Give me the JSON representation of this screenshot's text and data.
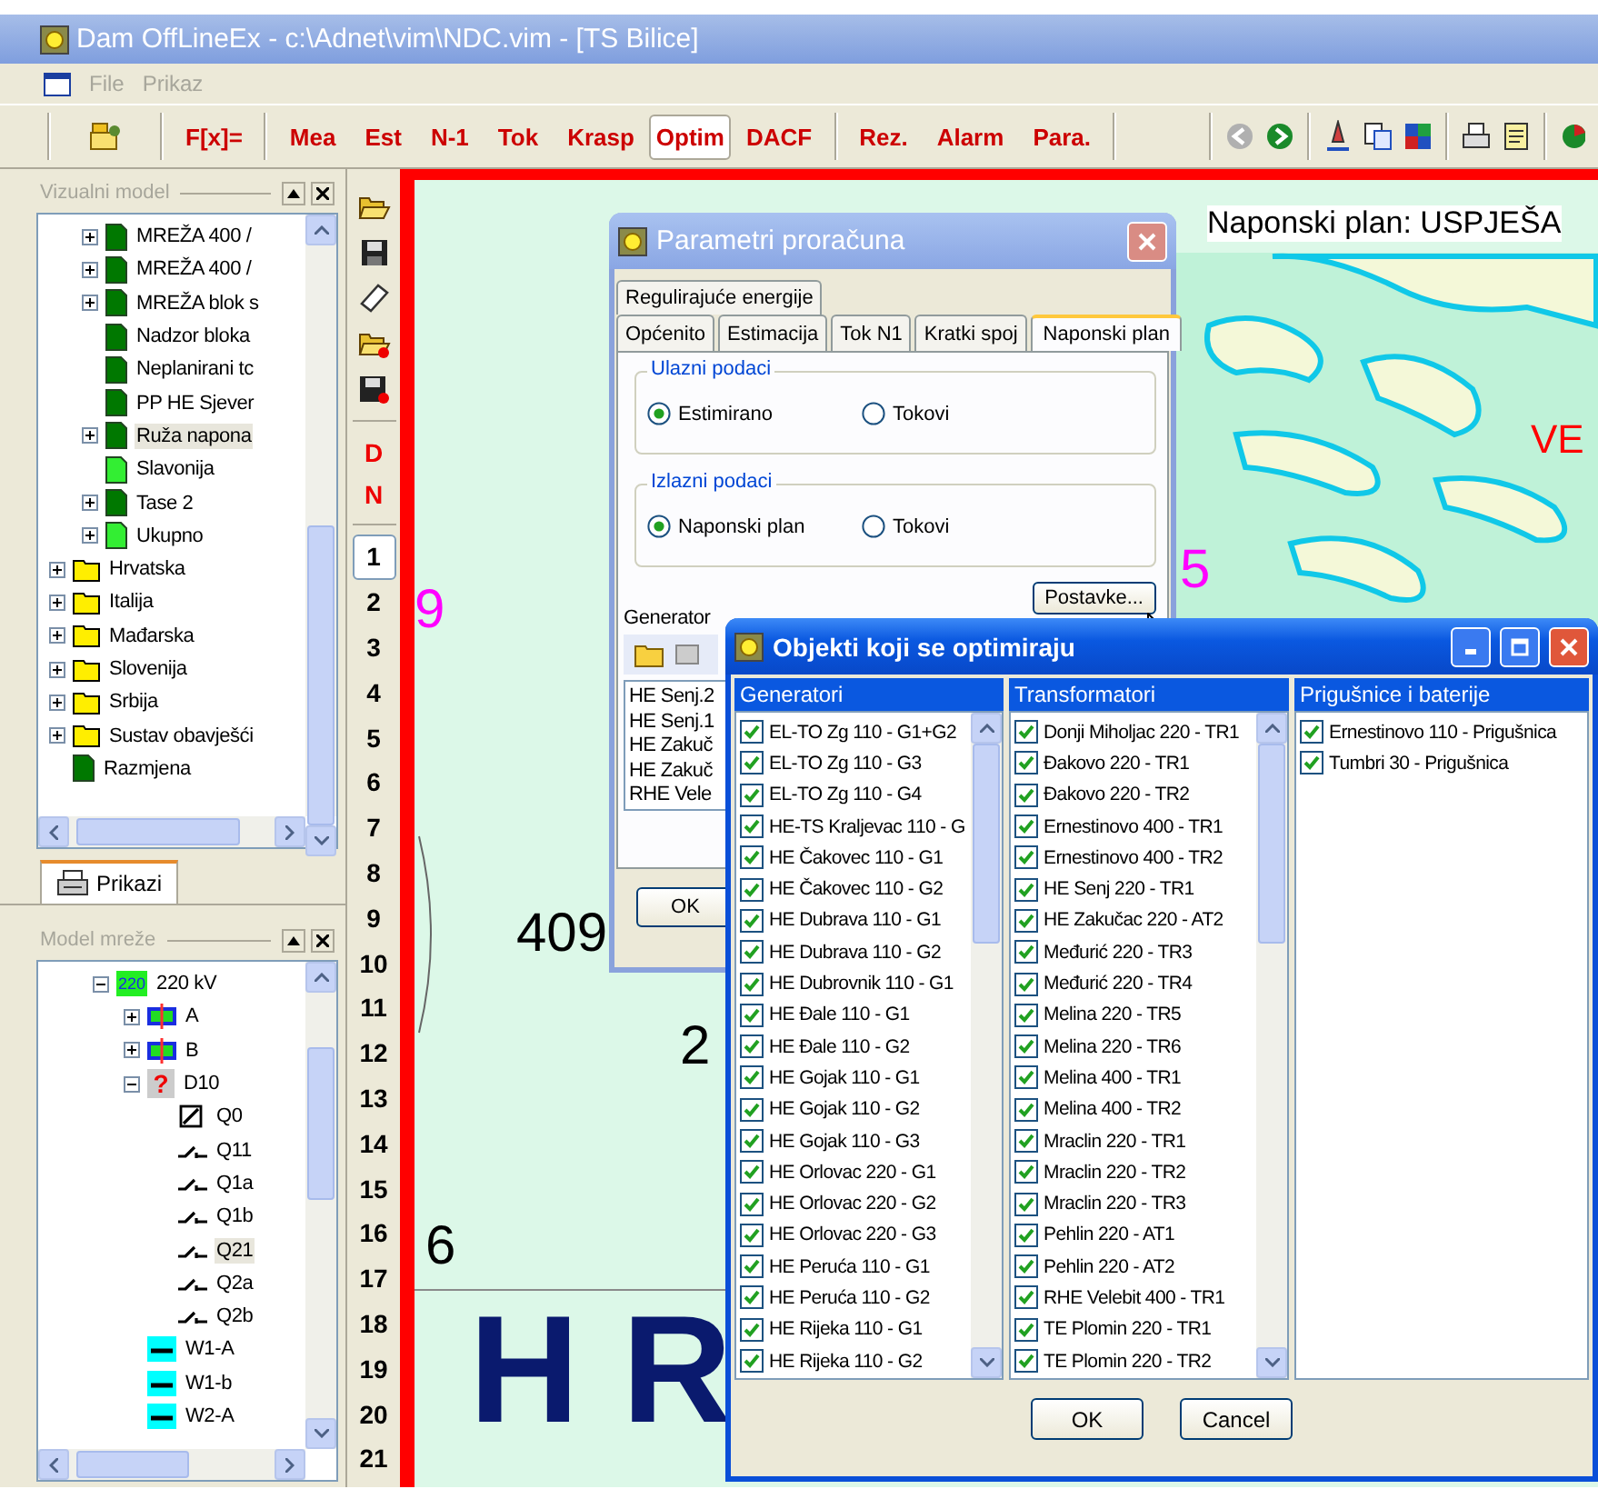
{
  "window": {
    "title": "Dam OffLineEx - c:\\Adnet\\vim\\NDC.vim - [TS Bilice]"
  },
  "menu": [
    {
      "label": "File",
      "disabled": true
    },
    {
      "label": "Prikaz",
      "disabled": true
    }
  ],
  "toolbar": {
    "buttons": [
      {
        "label": "F[x]=",
        "selected": false
      },
      {
        "label": "Mea",
        "selected": false
      },
      {
        "label": "Est",
        "selected": false
      },
      {
        "label": "N-1",
        "selected": false
      },
      {
        "label": "Tok",
        "selected": false
      },
      {
        "label": "Krasp",
        "selected": false
      },
      {
        "label": "Optim",
        "selected": true
      },
      {
        "label": "DACF",
        "selected": false
      },
      {
        "label": "Rez.",
        "selected": false
      },
      {
        "label": "Alarm",
        "selected": false
      },
      {
        "label": "Para.",
        "selected": false
      }
    ],
    "nav_buttons": [
      {
        "kind": "back",
        "disabled": true
      },
      {
        "kind": "forward",
        "disabled": false
      }
    ]
  },
  "visual_model": {
    "title": "Vizualni model",
    "nested_items": [
      {
        "label": "MREŽA 400 /",
        "kind": "page-dark",
        "expanded": false,
        "selected": false
      },
      {
        "label": "MREŽA 400 /",
        "kind": "page-dark",
        "expanded": false,
        "selected": false
      },
      {
        "label": "MREŽA blok s",
        "kind": "page-dark",
        "expanded": false,
        "selected": false
      },
      {
        "label": "Nadzor bloka",
        "kind": "page-dark",
        "selected": false
      },
      {
        "label": "Neplanirani tc",
        "kind": "page-dark",
        "selected": false
      },
      {
        "label": "PP HE Sjever",
        "kind": "page-dark",
        "selected": false
      },
      {
        "label": "Ruža napona",
        "kind": "page-dark",
        "expanded": false,
        "selected": true
      },
      {
        "label": "Slavonija",
        "kind": "page-light",
        "selected": false
      },
      {
        "label": "Tase 2",
        "kind": "page-dark",
        "expanded": false,
        "selected": false
      },
      {
        "label": "Ukupno",
        "kind": "page-light",
        "expanded": false,
        "selected": false
      }
    ],
    "items": [
      {
        "label": "Hrvatska",
        "kind": "folder",
        "expanded": false,
        "selected": false
      },
      {
        "label": "Italija",
        "kind": "folder",
        "expanded": false,
        "selected": false
      },
      {
        "label": "Mađarska",
        "kind": "folder",
        "expanded": false,
        "selected": false
      },
      {
        "label": "Slovenija",
        "kind": "folder",
        "expanded": false,
        "selected": false
      },
      {
        "label": "Srbija",
        "kind": "folder",
        "expanded": false,
        "selected": false
      },
      {
        "label": "Sustav obavješći",
        "kind": "folder",
        "expanded": false,
        "selected": false
      },
      {
        "label": "Razmjena",
        "kind": "page-dark",
        "selected": false
      }
    ]
  },
  "panel_tabs": [
    {
      "label": "Prikazi",
      "selected": true
    }
  ],
  "network_model": {
    "title": "Model mreže",
    "items": [
      {
        "label": "220 kV",
        "kind": "voltage",
        "badge": "220",
        "expanded": true,
        "selected": false,
        "children": [
          {
            "label": "A",
            "kind": "bus",
            "expanded": false,
            "selected": false
          },
          {
            "label": "B",
            "kind": "bus",
            "expanded": false,
            "selected": false
          },
          {
            "label": "D10",
            "kind": "unknown",
            "badge": "?",
            "expanded": true,
            "selected": false,
            "children": [
              {
                "label": "Q0",
                "kind": "breaker",
                "selected": false
              },
              {
                "label": "Q11",
                "kind": "switch",
                "selected": false
              },
              {
                "label": "Q1a",
                "kind": "switch",
                "selected": false
              },
              {
                "label": "Q1b",
                "kind": "switch",
                "selected": false
              },
              {
                "label": "Q21",
                "kind": "switch",
                "selected": true
              },
              {
                "label": "Q2a",
                "kind": "switch",
                "selected": false
              },
              {
                "label": "Q2b",
                "kind": "switch",
                "selected": false
              }
            ]
          },
          {
            "label": "W1-A",
            "kind": "line",
            "selected": false
          },
          {
            "label": "W1-b",
            "kind": "line",
            "selected": false
          },
          {
            "label": "W2-A",
            "kind": "line",
            "selected": false
          }
        ]
      }
    ]
  },
  "side_toolbar": {
    "modes": [
      "D",
      "N"
    ],
    "pages": [
      {
        "label": "1",
        "selected": true
      },
      {
        "label": "2",
        "selected": false
      },
      {
        "label": "3",
        "selected": false
      },
      {
        "label": "4",
        "selected": false
      },
      {
        "label": "5",
        "selected": false
      },
      {
        "label": "6",
        "selected": false
      },
      {
        "label": "7",
        "selected": false
      },
      {
        "label": "8",
        "selected": false
      },
      {
        "label": "9",
        "selected": false
      },
      {
        "label": "10",
        "selected": false
      },
      {
        "label": "11",
        "selected": false
      },
      {
        "label": "12",
        "selected": false
      },
      {
        "label": "13",
        "selected": false
      },
      {
        "label": "14",
        "selected": false
      },
      {
        "label": "15",
        "selected": false
      },
      {
        "label": "16",
        "selected": false
      },
      {
        "label": "17",
        "selected": false
      },
      {
        "label": "18",
        "selected": false
      },
      {
        "label": "19",
        "selected": false
      },
      {
        "label": "20",
        "selected": false
      },
      {
        "label": "21",
        "selected": false
      }
    ]
  },
  "canvas": {
    "title": "Naponski plan: USPJEŠA",
    "labels": [
      {
        "text": "VE",
        "kind": "area",
        "color": "#ff0000"
      },
      {
        "text": "409",
        "kind": "number",
        "color": "#000000"
      },
      {
        "text": "2",
        "kind": "number",
        "color": "#000000"
      },
      {
        "text": "6",
        "kind": "number",
        "color": "#000000"
      },
      {
        "text": "H R",
        "kind": "country",
        "color": "#0a1a6e"
      },
      {
        "text": "5",
        "kind": "number",
        "color": "#ff00ff"
      },
      {
        "text": "9",
        "kind": "number",
        "color": "#ff00ff"
      }
    ]
  },
  "parameters_dialog": {
    "title": "Parametri proračuna",
    "tab_rows": [
      [
        {
          "label": "Regulirajuće energije",
          "selected": false
        }
      ],
      [
        {
          "label": "Općenito",
          "selected": false
        },
        {
          "label": "Estimacija",
          "selected": false
        },
        {
          "label": "Tok N1",
          "selected": false
        },
        {
          "label": "Kratki spoj",
          "selected": false
        },
        {
          "label": "Naponski plan",
          "selected": true
        }
      ]
    ],
    "groups": [
      {
        "title": "Ulazni podaci",
        "options": [
          {
            "label": "Estimirano",
            "selected": true
          },
          {
            "label": "Tokovi",
            "selected": false
          }
        ]
      },
      {
        "title": "Izlazni podaci",
        "options": [
          {
            "label": "Naponski plan",
            "selected": true
          },
          {
            "label": "Tokovi",
            "selected": false
          }
        ]
      }
    ],
    "settings_button": "Postavke...",
    "generator_label": "Generator",
    "generator_list": [
      "HE Senj.2",
      "HE Senj.1",
      "HE Zakuč",
      "HE Zakuč",
      "RHE Vele"
    ],
    "ok_button": "OK"
  },
  "objects_dialog": {
    "title": "Objekti koji se optimiraju",
    "columns": [
      {
        "header": "Generatori",
        "scrollable": true,
        "items": [
          {
            "label": "EL-TO Zg 110 - G1+G2",
            "checked": true
          },
          {
            "label": "EL-TO Zg 110 - G3",
            "checked": true
          },
          {
            "label": "EL-TO Zg 110 - G4",
            "checked": true
          },
          {
            "label": "HE-TS Kraljevac 110 - G",
            "checked": true
          },
          {
            "label": "HE Čakovec 110 - G1",
            "checked": true
          },
          {
            "label": "HE Čakovec 110 - G2",
            "checked": true
          },
          {
            "label": "HE Dubrava 110 - G1",
            "checked": true
          },
          {
            "label": "HE Dubrava 110 - G2",
            "checked": true
          },
          {
            "label": "HE Dubrovnik 110 - G1",
            "checked": true
          },
          {
            "label": "HE Đale 110 - G1",
            "checked": true
          },
          {
            "label": "HE Đale 110 - G2",
            "checked": true
          },
          {
            "label": "HE Gojak 110 - G1",
            "checked": true
          },
          {
            "label": "HE Gojak 110 - G2",
            "checked": true
          },
          {
            "label": "HE Gojak 110 - G3",
            "checked": true
          },
          {
            "label": "HE Orlovac 220 - G1",
            "checked": true
          },
          {
            "label": "HE Orlovac 220 - G2",
            "checked": true
          },
          {
            "label": "HE Orlovac 220 - G3",
            "checked": true
          },
          {
            "label": "HE Peruća 110 - G1",
            "checked": true
          },
          {
            "label": "HE Peruća 110 - G2",
            "checked": true
          },
          {
            "label": "HE Rijeka 110 - G1",
            "checked": true
          },
          {
            "label": "HE Rijeka 110 - G2",
            "checked": true
          }
        ]
      },
      {
        "header": "Transformatori",
        "scrollable": true,
        "items": [
          {
            "label": "Donji Miholjac 220 - TR1",
            "checked": true
          },
          {
            "label": "Đakovo 220 - TR1",
            "checked": true
          },
          {
            "label": "Đakovo 220 - TR2",
            "checked": true
          },
          {
            "label": "Ernestinovo 400 - TR1",
            "checked": true
          },
          {
            "label": "Ernestinovo 400 - TR2",
            "checked": true
          },
          {
            "label": "HE Senj 220 - TR1",
            "checked": true
          },
          {
            "label": "HE Zakučac 220 - AT2",
            "checked": true
          },
          {
            "label": "Međurić 220 - TR3",
            "checked": true
          },
          {
            "label": "Međurić 220 - TR4",
            "checked": true
          },
          {
            "label": "Melina 220 - TR5",
            "checked": true
          },
          {
            "label": "Melina 220 - TR6",
            "checked": true
          },
          {
            "label": "Melina 400 - TR1",
            "checked": true
          },
          {
            "label": "Melina 400 - TR2",
            "checked": true
          },
          {
            "label": "Mraclin 220 - TR1",
            "checked": true
          },
          {
            "label": "Mraclin 220 - TR2",
            "checked": true
          },
          {
            "label": "Mraclin 220 - TR3",
            "checked": true
          },
          {
            "label": "Pehlin 220 - AT1",
            "checked": true
          },
          {
            "label": "Pehlin 220 - AT2",
            "checked": true
          },
          {
            "label": "RHE Velebit 400 - TR1",
            "checked": true
          },
          {
            "label": "TE Plomin 220 - TR1",
            "checked": true
          },
          {
            "label": "TE Plomin 220 - TR2",
            "checked": true
          }
        ]
      },
      {
        "header": "Prigušnice i baterije",
        "scrollable": false,
        "items": [
          {
            "label": "Ernestinovo 110 - Prigušnica",
            "checked": true
          },
          {
            "label": "Tumbri 30 - Prigušnica",
            "checked": true
          }
        ]
      }
    ],
    "buttons": [
      "OK",
      "Cancel"
    ]
  }
}
